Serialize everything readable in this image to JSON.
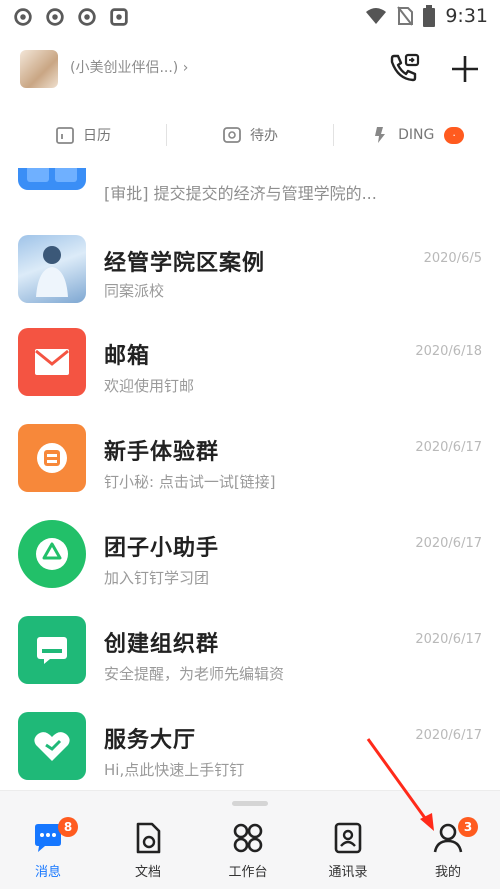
{
  "status_bar": {
    "time": "9:31",
    "left_icons": [
      "gear-icon",
      "gear-icon",
      "gear-icon",
      "gear-icon"
    ],
    "right_icons": [
      "wifi-icon",
      "no-sim-icon",
      "battery-icon"
    ]
  },
  "header": {
    "org_name": "(小美创业伴侣...) ›",
    "actions": [
      "call-icon",
      "plus-icon"
    ]
  },
  "tabs": [
    {
      "label": "日历",
      "icon": "calendar-icon"
    },
    {
      "label": "待办",
      "icon": "todo-icon"
    },
    {
      "label": "DING",
      "icon": "ding-icon",
      "badge": "·"
    }
  ],
  "top_partial": {
    "text": "[审批] 提交提交的经济与管理学院的... "
  },
  "conversations": [
    {
      "title": "经管学院区案例",
      "subtitle": "同案派校",
      "date": "2020/6/5",
      "icon": "photo-avatar"
    },
    {
      "title": "邮箱",
      "subtitle": "欢迎使用钉邮",
      "date": "2020/6/18",
      "icon": "mail-icon",
      "color": "#f45442"
    },
    {
      "title": "新手体验群",
      "subtitle": "钉小秘: 点击试一试[链接]",
      "date": "2020/6/17",
      "icon": "group-icon",
      "color": "#f7883a"
    },
    {
      "title": "团子小助手",
      "subtitle": "加入钉钉学习团",
      "date": "2020/6/17",
      "icon": "recycle-icon",
      "color": "#22c069"
    },
    {
      "title": "创建组织群",
      "subtitle": "安全提醒，为老师先编辑资",
      "date": "2020/6/17",
      "icon": "chat-icon",
      "color": "#1fb978"
    },
    {
      "title": "服务大厅",
      "subtitle": "Hi,点此快速上手钉钉",
      "date": "2020/6/17",
      "icon": "heart-icon",
      "color": "#1fb978"
    }
  ],
  "bottom_nav": [
    {
      "label": "消息",
      "icon": "message-icon",
      "badge": "8",
      "active": true
    },
    {
      "label": "文档",
      "icon": "doc-icon"
    },
    {
      "label": "工作台",
      "icon": "workbench-icon"
    },
    {
      "label": "通讯录",
      "icon": "contacts-icon"
    },
    {
      "label": "我的",
      "icon": "profile-icon",
      "badge": "3"
    }
  ],
  "colors": {
    "accent": "#1677ff",
    "badge": "#ff5b1f",
    "mail": "#f45442",
    "orange": "#f7883a",
    "green": "#22c069"
  }
}
